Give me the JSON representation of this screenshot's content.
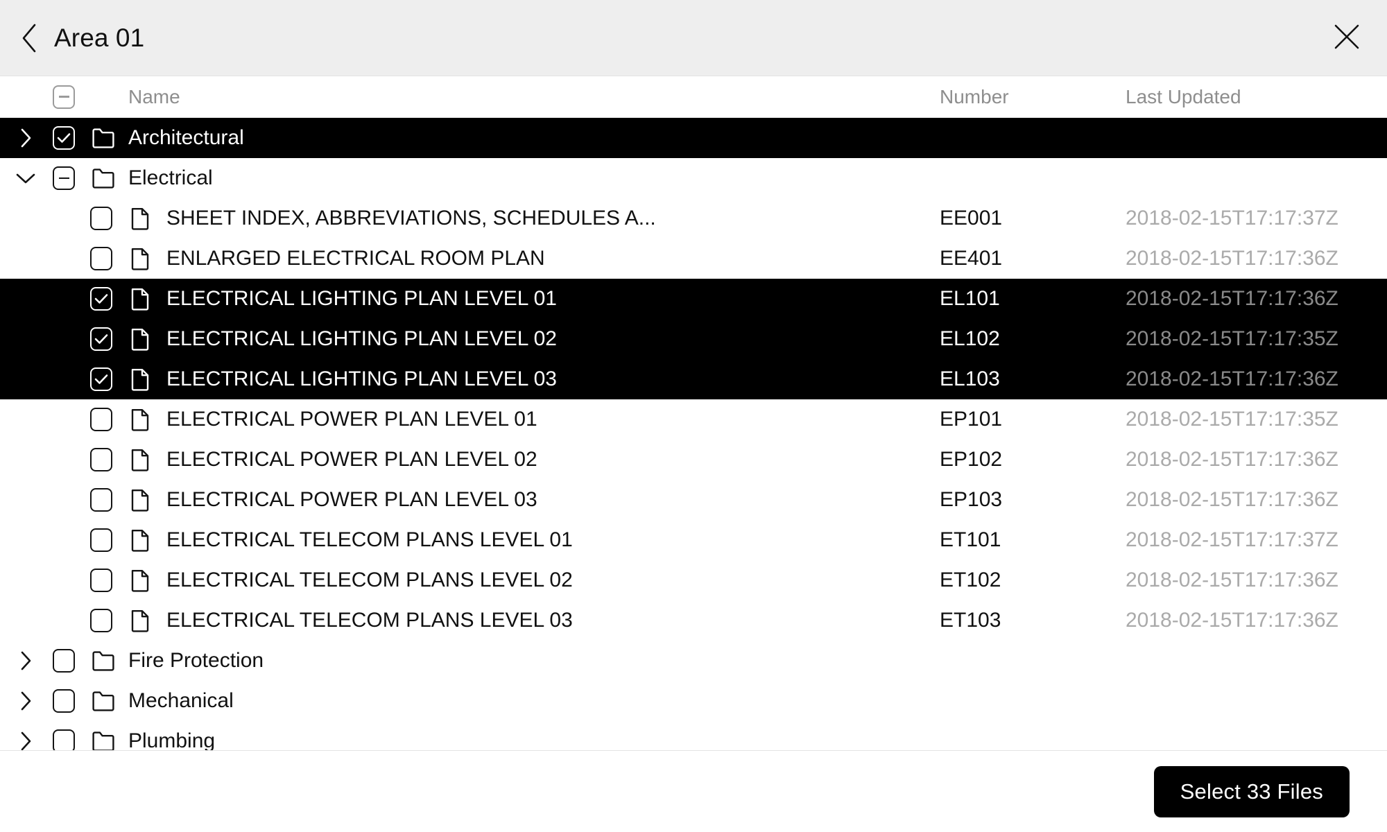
{
  "header": {
    "title": "Area 01",
    "back_icon": "chevron-left-icon",
    "close_icon": "close-icon"
  },
  "columns": {
    "select_all_state": "indeterminate",
    "name": "Name",
    "number": "Number",
    "last_updated": "Last Updated"
  },
  "rows": [
    {
      "type": "folder",
      "expanded": false,
      "chevron": "chevron-right-icon",
      "checkbox": "checked",
      "name": "Architectural",
      "number": "",
      "date": "",
      "selected": true
    },
    {
      "type": "folder",
      "expanded": true,
      "chevron": "chevron-down-icon",
      "checkbox": "indeterminate",
      "name": "Electrical",
      "number": "",
      "date": "",
      "selected": false
    },
    {
      "type": "file",
      "expanded": null,
      "chevron": "",
      "checkbox": "unchecked",
      "name": "SHEET INDEX, ABBREVIATIONS, SCHEDULES A...",
      "number": "EE001",
      "date": "2018-02-15T17:17:37Z",
      "selected": false
    },
    {
      "type": "file",
      "expanded": null,
      "chevron": "",
      "checkbox": "unchecked",
      "name": "ENLARGED ELECTRICAL ROOM PLAN",
      "number": "EE401",
      "date": "2018-02-15T17:17:36Z",
      "selected": false
    },
    {
      "type": "file",
      "expanded": null,
      "chevron": "",
      "checkbox": "checked",
      "name": "ELECTRICAL LIGHTING PLAN LEVEL 01",
      "number": "EL101",
      "date": "2018-02-15T17:17:36Z",
      "selected": true
    },
    {
      "type": "file",
      "expanded": null,
      "chevron": "",
      "checkbox": "checked",
      "name": "ELECTRICAL LIGHTING PLAN LEVEL 02",
      "number": "EL102",
      "date": "2018-02-15T17:17:35Z",
      "selected": true
    },
    {
      "type": "file",
      "expanded": null,
      "chevron": "",
      "checkbox": "checked",
      "name": "ELECTRICAL LIGHTING PLAN LEVEL 03",
      "number": "EL103",
      "date": "2018-02-15T17:17:36Z",
      "selected": true
    },
    {
      "type": "file",
      "expanded": null,
      "chevron": "",
      "checkbox": "unchecked",
      "name": "ELECTRICAL POWER PLAN LEVEL 01",
      "number": "EP101",
      "date": "2018-02-15T17:17:35Z",
      "selected": false
    },
    {
      "type": "file",
      "expanded": null,
      "chevron": "",
      "checkbox": "unchecked",
      "name": "ELECTRICAL POWER PLAN LEVEL 02",
      "number": "EP102",
      "date": "2018-02-15T17:17:36Z",
      "selected": false
    },
    {
      "type": "file",
      "expanded": null,
      "chevron": "",
      "checkbox": "unchecked",
      "name": "ELECTRICAL POWER PLAN LEVEL 03",
      "number": "EP103",
      "date": "2018-02-15T17:17:36Z",
      "selected": false
    },
    {
      "type": "file",
      "expanded": null,
      "chevron": "",
      "checkbox": "unchecked",
      "name": "ELECTRICAL TELECOM PLANS LEVEL 01",
      "number": "ET101",
      "date": "2018-02-15T17:17:37Z",
      "selected": false
    },
    {
      "type": "file",
      "expanded": null,
      "chevron": "",
      "checkbox": "unchecked",
      "name": "ELECTRICAL TELECOM PLANS LEVEL 02",
      "number": "ET102",
      "date": "2018-02-15T17:17:36Z",
      "selected": false
    },
    {
      "type": "file",
      "expanded": null,
      "chevron": "",
      "checkbox": "unchecked",
      "name": "ELECTRICAL TELECOM PLANS LEVEL 03",
      "number": "ET103",
      "date": "2018-02-15T17:17:36Z",
      "selected": false
    },
    {
      "type": "folder",
      "expanded": false,
      "chevron": "chevron-right-icon",
      "checkbox": "unchecked",
      "name": "Fire Protection",
      "number": "",
      "date": "",
      "selected": false
    },
    {
      "type": "folder",
      "expanded": false,
      "chevron": "chevron-right-icon",
      "checkbox": "unchecked",
      "name": "Mechanical",
      "number": "",
      "date": "",
      "selected": false
    },
    {
      "type": "folder",
      "expanded": false,
      "chevron": "chevron-right-icon",
      "checkbox": "unchecked",
      "name": "Plumbing",
      "number": "",
      "date": "",
      "selected": false
    }
  ],
  "footer": {
    "select_label": "Select 33 Files"
  },
  "colors": {
    "titlebar_bg": "#eeeeee",
    "selection_bg": "#000000",
    "selection_fg": "#ffffff",
    "muted_text": "#8e8e8e",
    "date_text": "#aaaaaa",
    "button_bg": "#000000"
  }
}
